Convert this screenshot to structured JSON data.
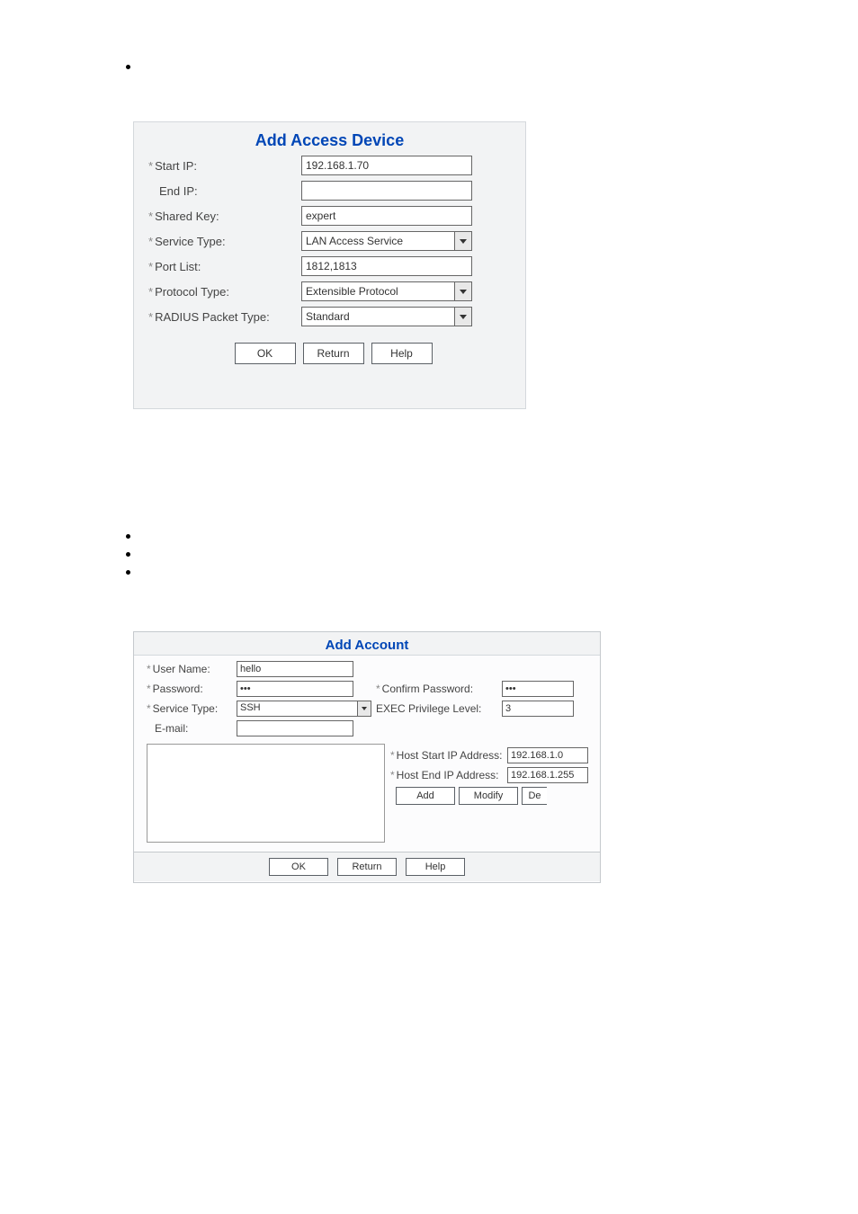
{
  "panel1": {
    "title": "Add Access Device",
    "fields": {
      "start_ip": {
        "label": "Start IP:",
        "value": "192.168.1.70",
        "required": true
      },
      "end_ip": {
        "label": "End IP:",
        "value": "",
        "required": false
      },
      "shared_key": {
        "label": "Shared Key:",
        "value": "expert",
        "required": true
      },
      "service": {
        "label": "Service Type:",
        "value": "LAN Access Service",
        "required": true
      },
      "port_list": {
        "label": "Port List:",
        "value": "1812,1813",
        "required": true
      },
      "protocol": {
        "label": "Protocol Type:",
        "value": "Extensible Protocol",
        "required": true
      },
      "radius_pkt": {
        "label": "RADIUS Packet Type:",
        "value": "Standard",
        "required": true
      }
    },
    "buttons": {
      "ok": "OK",
      "return": "Return",
      "help": "Help"
    }
  },
  "panel2": {
    "title": "Add Account",
    "fields": {
      "user_name": {
        "label": "User Name:",
        "value": "hello",
        "required": true
      },
      "password": {
        "label": "Password:",
        "value": "•••",
        "required": true
      },
      "confirm_pw": {
        "label": "Confirm Password:",
        "value": "•••",
        "required": true
      },
      "service": {
        "label": "Service Type:",
        "value": "SSH",
        "required": true
      },
      "exec_priv": {
        "label": "EXEC Privilege Level:",
        "value": "3",
        "required": false
      },
      "email": {
        "label": "E-mail:",
        "value": "",
        "required": false
      },
      "host_start": {
        "label": "Host Start IP Address:",
        "value": "192.168.1.0",
        "required": true
      },
      "host_end": {
        "label": "Host End IP Address:",
        "value": "192.168.1.255",
        "required": true
      }
    },
    "buttons": {
      "add": "Add",
      "modify": "Modify",
      "delete_cut": "De",
      "ok": "OK",
      "return": "Return",
      "help": "Help"
    }
  }
}
